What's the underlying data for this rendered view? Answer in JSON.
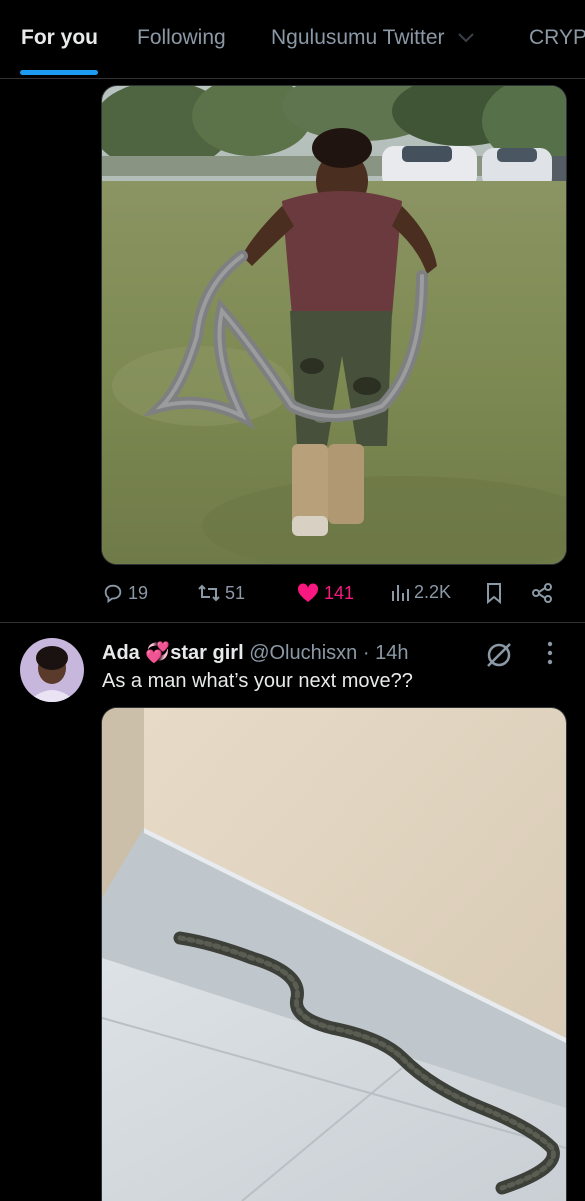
{
  "tabs": [
    {
      "label": "For you",
      "active": true
    },
    {
      "label": "Following",
      "active": false
    },
    {
      "label": "Ngulusumu Twitter",
      "active": false
    },
    {
      "label": "CRYP",
      "active": false
    }
  ],
  "tweet1": {
    "stats": {
      "replies": "19",
      "reposts": "51",
      "likes": "141",
      "views": "2.2K",
      "liked": true
    }
  },
  "tweet2": {
    "display_name": "Ada",
    "name_emoji": "💞",
    "display_name_suffix": "star girl",
    "handle": "@Oluchisxn",
    "separator": "·",
    "time": "14h",
    "text": "As a man what’s your next move??"
  },
  "colors": {
    "accent": "#1d9bf0",
    "like": "#f91880",
    "muted": "#8b98a5",
    "text": "#e7e9ea",
    "bg": "#000000"
  },
  "icons": [
    "reply-icon",
    "repost-icon",
    "like-icon",
    "views-icon",
    "bookmark-icon",
    "share-icon",
    "grok-icon",
    "more-icon"
  ]
}
